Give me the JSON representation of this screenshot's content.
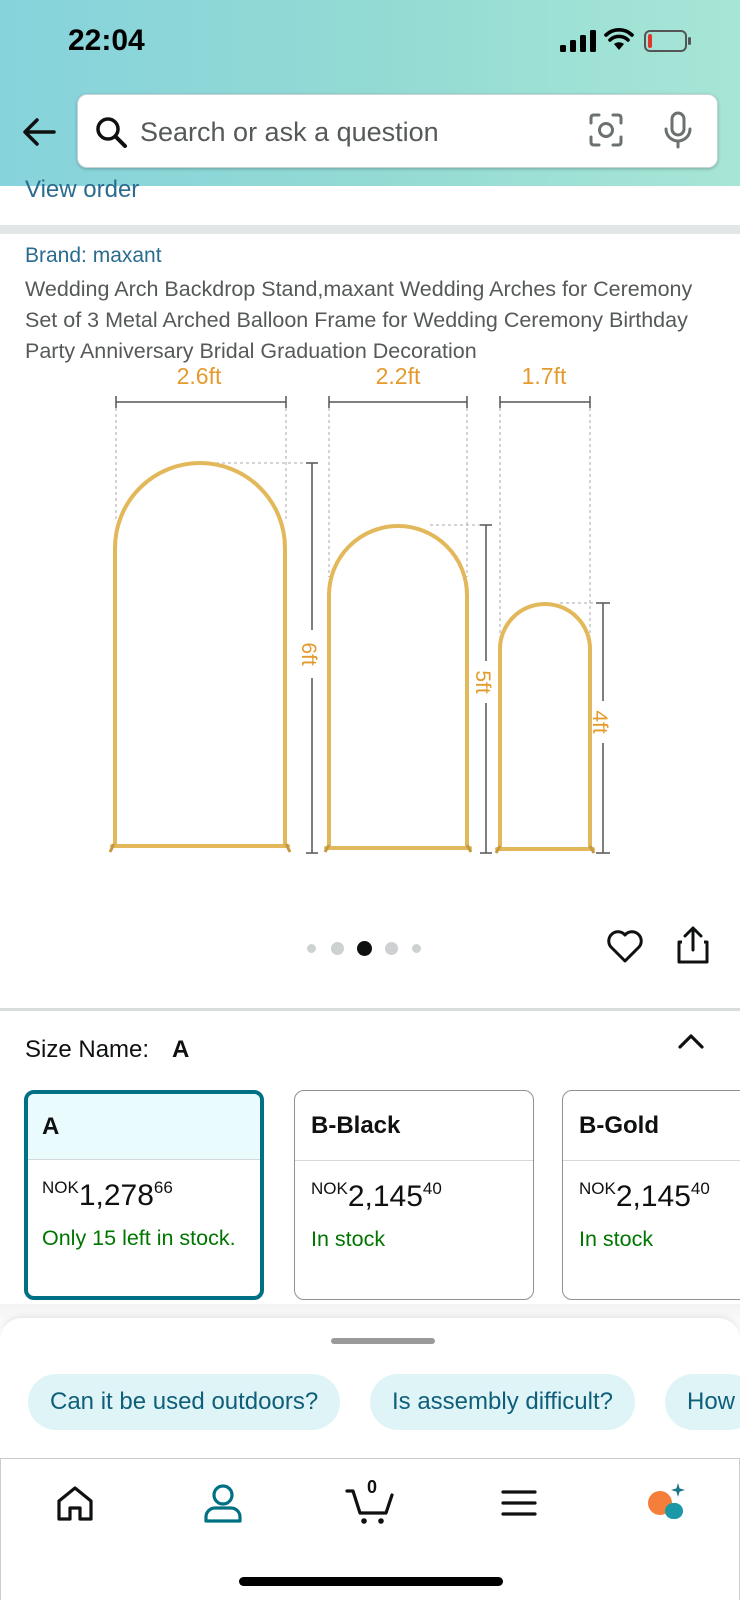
{
  "status_bar": {
    "time": "22:04"
  },
  "search": {
    "placeholder": "Search or ask a question"
  },
  "links": {
    "view_order": "View order"
  },
  "product": {
    "brand": "Brand: maxant",
    "title": "Wedding Arch Backdrop Stand,maxant Wedding Arches for Ceremony Set of 3 Metal Arched Balloon Frame for Wedding Ceremony Birthday Party Anniversary Bridal Graduation Decoration",
    "image_labels": {
      "w1": "2.6ft",
      "w2": "2.2ft",
      "w3": "1.7ft",
      "h1": "6ft",
      "h2": "5ft",
      "h3": "4ft"
    },
    "carousel": {
      "count": 5,
      "active_index": 2
    }
  },
  "size": {
    "label": "Size Name:",
    "selected": "A",
    "options": [
      {
        "name": "A",
        "currency": "NOK",
        "whole": "1,278",
        "fraction": "66",
        "stock": "Only 15 left in stock.",
        "selected": true
      },
      {
        "name": "B-Black",
        "currency": "NOK",
        "whole": "2,145",
        "fraction": "40",
        "stock": "In stock",
        "selected": false
      },
      {
        "name": "B-Gold",
        "currency": "NOK",
        "whole": "2,145",
        "fraction": "40",
        "stock": "In stock",
        "selected": false
      }
    ]
  },
  "questions": {
    "chips": [
      "Can it be used outdoors?",
      "Is assembly difficult?",
      "How"
    ]
  },
  "tabbar": {
    "cart_count": "0",
    "icons": [
      "home-icon",
      "account-icon",
      "cart-icon",
      "menu-icon",
      "rufus-icon"
    ]
  },
  "colors": {
    "accent_teal": "#007185",
    "link_blue": "#2a6b8f",
    "in_stock_green": "#007600",
    "arch_gold": "#e2b85a",
    "dimension_orange": "#e49a2c",
    "rufus_orange": "#f57f3a"
  }
}
